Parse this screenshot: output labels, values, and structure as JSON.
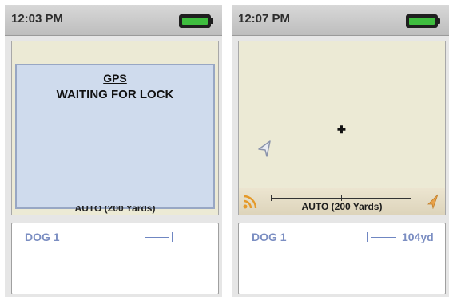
{
  "screens": [
    {
      "status": {
        "time": "12:03 PM",
        "battery_icon": "battery-full-icon",
        "battery_level": 1.0
      },
      "gps": {
        "title": "GPS",
        "message": "WAITING FOR LOCK"
      },
      "scale_label": "AUTO (200 Yards)",
      "dog": {
        "name": "DOG 1",
        "distance": ""
      }
    },
    {
      "status": {
        "time": "12:07 PM",
        "battery_icon": "battery-full-icon",
        "battery_level": 1.0
      },
      "map": {
        "crosshair_icon": "crosshair-icon",
        "arrow_icon": "navigation-arrow-icon",
        "signal_icon": "signal-icon",
        "compass_icon": "compass-icon",
        "scale_label": "AUTO (200 Yards)"
      },
      "dog": {
        "name": "DOG 1",
        "distance": "104yd"
      }
    }
  ],
  "colors": {
    "dog_text": "#7b8ec2",
    "battery": "#3fbe3f",
    "gps_panel": "#cfdbed",
    "map_background": "#ecead5"
  }
}
